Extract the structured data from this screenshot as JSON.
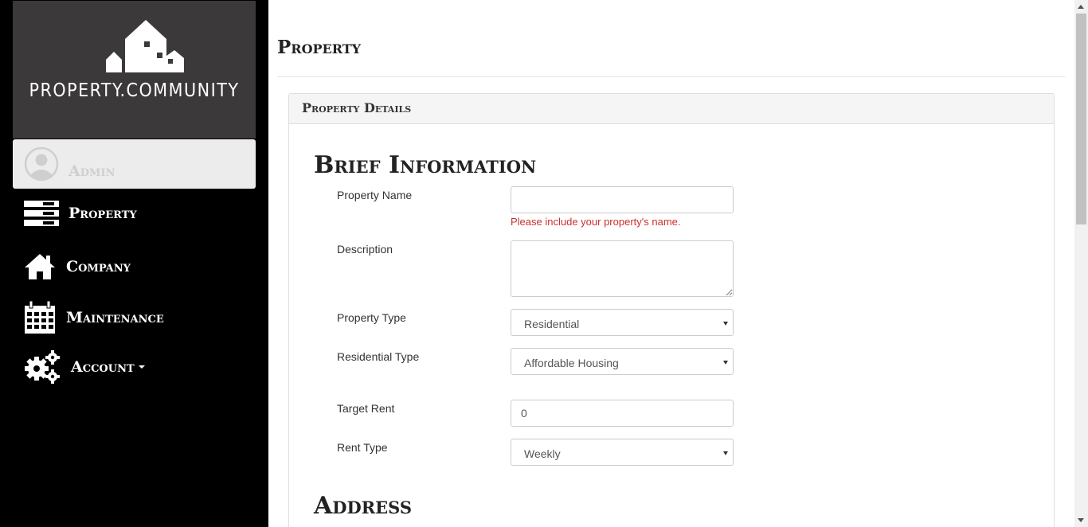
{
  "sidebar": {
    "logo_text": "PROPERTY.COMMUNITY",
    "user": {
      "name": "Admin"
    },
    "nav": [
      {
        "label": "Property",
        "icon": "property-list-icon"
      },
      {
        "label": "Company",
        "icon": "home-icon"
      },
      {
        "label": "Maintenance",
        "icon": "calendar-icon"
      },
      {
        "label": "Account",
        "icon": "gears-icon",
        "has_dropdown": true
      }
    ]
  },
  "main": {
    "page_title": "Property",
    "panel_title": "Property Details",
    "sections": {
      "brief": "Brief Information",
      "address": "Address"
    },
    "form": {
      "property_name": {
        "label": "Property Name",
        "value": "",
        "error": "Please include your property's name."
      },
      "description": {
        "label": "Description",
        "value": ""
      },
      "property_type": {
        "label": "Property Type",
        "value": "Residential"
      },
      "residential_type": {
        "label": "Residential Type",
        "value": "Affordable Housing"
      },
      "target_rent": {
        "label": "Target Rent",
        "value": "0"
      },
      "rent_type": {
        "label": "Rent Type",
        "value": "Weekly"
      }
    }
  },
  "colors": {
    "sidebar_bg": "#000000",
    "logo_bg": "#3b393a",
    "error": "#c9302c"
  }
}
